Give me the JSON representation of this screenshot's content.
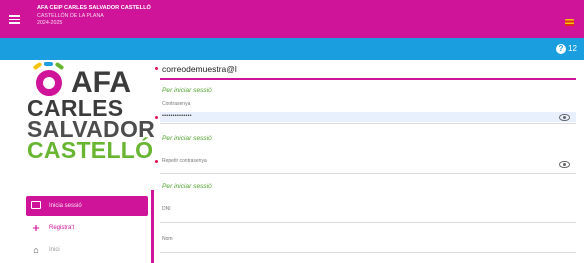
{
  "header": {
    "title": "AFA CEIP CARLES SALVADOR CASTELLÓ",
    "subtitle_line1": "CASTELLÓN DE LA PLANA",
    "subtitle_line2": "2024-2025",
    "flag_icon": "spain-flag-icon"
  },
  "help": {
    "icon": "help-icon",
    "count": "12"
  },
  "logo": {
    "afa": "AFA",
    "line1": "CARLES",
    "line2": "SALVADOR",
    "line3": "CASTELLÓ",
    "colors": {
      "pink": "#d0149a",
      "green": "#68b532",
      "yellow": "#f3c20f",
      "blue": "#1b9ee0",
      "dark": "#3b3b3b"
    }
  },
  "menu": {
    "items": [
      {
        "label": "Inicia sessió",
        "icon": "login-icon",
        "active": true
      },
      {
        "label": "Registra't",
        "icon": "add-user-icon",
        "active": false
      },
      {
        "label": "Inici",
        "icon": "home-icon",
        "active": false
      }
    ]
  },
  "form": {
    "email_value": "correodemuestra@l",
    "email_hint": "Per iniciar sessió",
    "password_label": "Contrasenya",
    "password_value": "••••••••••••••",
    "password_hint": "Per iniciar sessió",
    "repeat_label": "Repetir contrasenya",
    "repeat_hint": "Per iniciar sessió",
    "dni_label": "DNI",
    "name_label": "Nom"
  },
  "colors": {
    "primary": "#d0149a",
    "accent": "#1b9ee0",
    "hint": "#53a32e",
    "required": "#e3105a"
  }
}
